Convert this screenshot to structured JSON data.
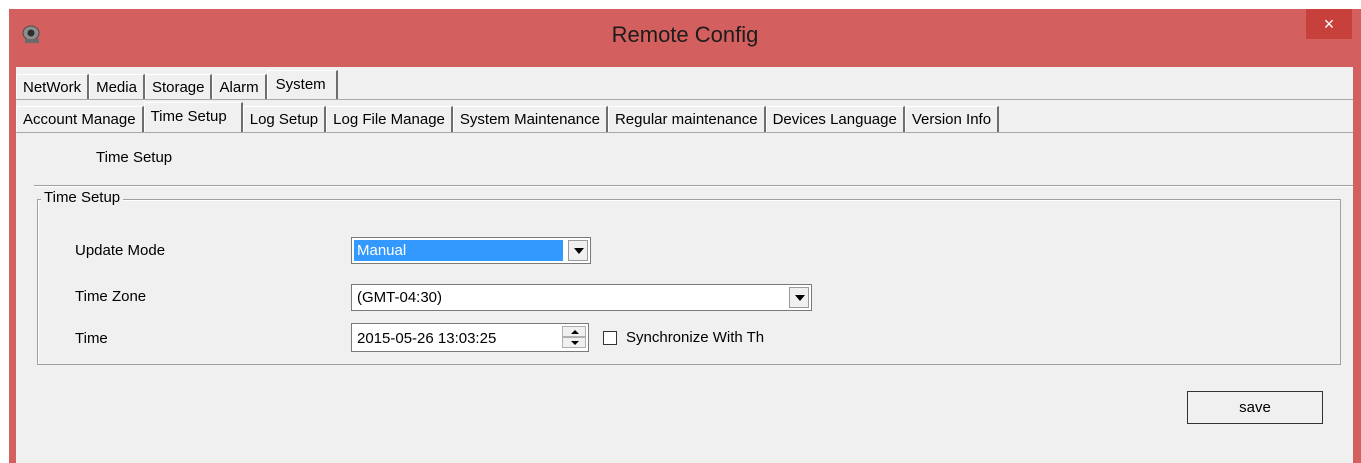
{
  "window": {
    "title": "Remote Config",
    "close_label": "×",
    "app_icon": "camera-icon",
    "colors": {
      "titlebar": "#d3605e",
      "close": "#c7403b",
      "selection": "#3399ff"
    }
  },
  "main_tabs": [
    "NetWork",
    "Media",
    "Storage",
    "Alarm",
    "System"
  ],
  "main_tabs_active": "System",
  "sub_tabs": [
    "Account Manage",
    "Time Setup",
    "Log Setup",
    "Log File Manage",
    "System Maintenance",
    "Regular maintenance",
    "Devices Language",
    "Version Info"
  ],
  "sub_tabs_active": "Time Setup",
  "panel": {
    "section_title": "Time Setup",
    "group_title": "Time Setup",
    "update_mode": {
      "label": "Update Mode",
      "value": "Manual"
    },
    "time_zone": {
      "label": "Time Zone",
      "value": "(GMT-04:30)"
    },
    "time": {
      "label": "Time",
      "value": "2015-05-26 13:03:25"
    },
    "sync": {
      "label": "Synchronize With Th",
      "checked": false
    },
    "save_label": "save"
  }
}
